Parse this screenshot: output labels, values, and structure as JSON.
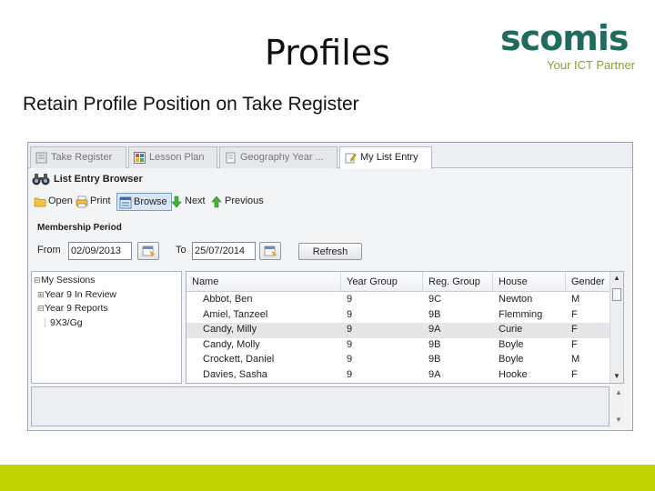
{
  "slide": {
    "title": "Profiles",
    "subtitle": "Retain Profile Position on Take Register"
  },
  "logo": {
    "word": "scomis",
    "tagline": "Your ICT Partner"
  },
  "tabs": [
    {
      "label": "Take Register",
      "icon": "register-icon"
    },
    {
      "label": "Lesson Plan",
      "icon": "lesson-plan-icon"
    },
    {
      "label": "Geography Year ...",
      "icon": "document-icon"
    },
    {
      "label": "My List Entry",
      "icon": "edit-list-icon"
    }
  ],
  "section": {
    "title": "List Entry Browser",
    "icon": "binoculars-icon"
  },
  "toolbar": {
    "open": "Open",
    "print": "Print",
    "browse": "Browse",
    "next": "Next",
    "previous": "Previous"
  },
  "membership": {
    "title": "Membership Period",
    "from_label": "From",
    "from_value": "02/09/2013",
    "to_label": "To",
    "to_value": "25/07/2014",
    "refresh": "Refresh"
  },
  "tree": [
    {
      "label": "My Sessions",
      "expander": "⊟"
    },
    {
      "label": "Year 9 In Review",
      "expander": "⊞"
    },
    {
      "label": "Year 9 Reports",
      "expander": "⊟"
    },
    {
      "label": "9X3/Gg",
      "expander": ""
    }
  ],
  "grid": {
    "columns": [
      "Name",
      "Year Group",
      "Reg. Group",
      "House",
      "Gender"
    ],
    "rows": [
      [
        "Abbot, Ben",
        "9",
        "9C",
        "Newton",
        "M"
      ],
      [
        "Amiel, Tanzeel",
        "9",
        "9B",
        "Flemming",
        "F"
      ],
      [
        "Candy, Milly",
        "9",
        "9A",
        "Curie",
        "F"
      ],
      [
        "Candy, Molly",
        "9",
        "9B",
        "Boyle",
        "F"
      ],
      [
        "Crockett, Daniel",
        "9",
        "9B",
        "Boyle",
        "M"
      ],
      [
        "Davies, Sasha",
        "9",
        "9A",
        "Hooke",
        "F"
      ]
    ],
    "selected_row": 2
  },
  "colors": {
    "accent_green": "#c2d500",
    "logo_teal": "#1f6b5f",
    "selected_row": "#e4e6e8"
  }
}
